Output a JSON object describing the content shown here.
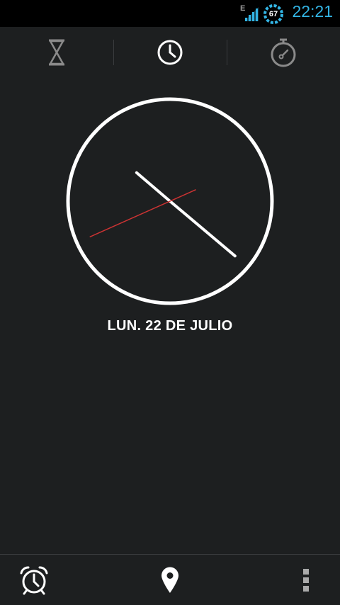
{
  "status_bar": {
    "network_type": "E",
    "battery_level": "67",
    "time": "22:21",
    "accent_color": "#33b5e5"
  },
  "tabs": [
    {
      "name": "timer",
      "icon": "hourglass-icon",
      "selected": false
    },
    {
      "name": "clock",
      "icon": "clock-icon",
      "selected": true
    },
    {
      "name": "stopwatch",
      "icon": "stopwatch-icon",
      "selected": false
    }
  ],
  "clock": {
    "hour": 22,
    "minute": 21,
    "second": 41,
    "second_hand_color": "#cc3333"
  },
  "date": {
    "label": "LUN. 22 DE JULIO"
  },
  "bottom_bar": {
    "alarm_icon": "alarm-clock-icon",
    "cities_icon": "map-pin-icon",
    "menu_icon": "overflow-menu-icon"
  }
}
